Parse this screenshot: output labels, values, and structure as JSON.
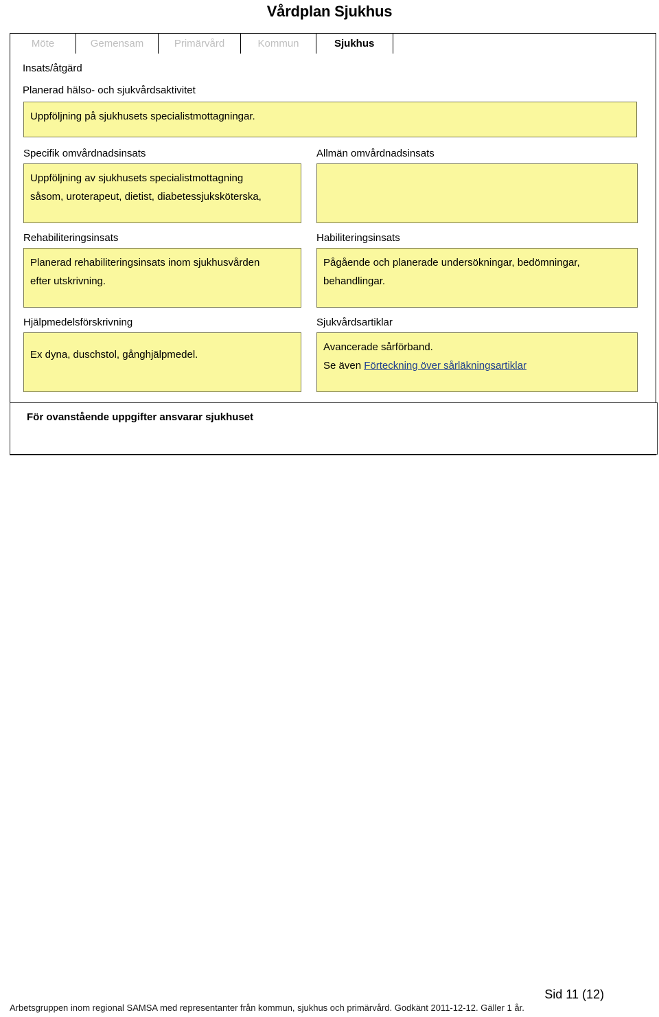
{
  "document": {
    "title": "Vårdplan Sjukhus"
  },
  "tabs": [
    {
      "label": "Möte",
      "active": false
    },
    {
      "label": "Gemensam",
      "active": false
    },
    {
      "label": "Primärvård",
      "active": false
    },
    {
      "label": "Kommun",
      "active": false
    },
    {
      "label": "Sjukhus",
      "active": true
    }
  ],
  "panel": {
    "section_heading": "Insats/åtgärd",
    "activity": {
      "label": "Planerad hälso- och sjukvårdsaktivitet",
      "value": "Uppföljning på sjukhusets specialistmottagningar."
    },
    "rows": [
      {
        "left": {
          "label": "Specifik omvårdnadsinsats",
          "lines": [
            "Uppföljning av sjukhusets specialistmottagning",
            "såsom, uroterapeut, dietist, diabetessjuksköterska,"
          ]
        },
        "right": {
          "label": "Allmän omvårdnadsinsats",
          "lines": []
        }
      },
      {
        "left": {
          "label": "Rehabiliteringsinsats",
          "lines": [
            "Planerad rehabiliteringsinsats inom sjukhusvården",
            "efter utskrivning."
          ]
        },
        "right": {
          "label": "Habiliteringsinsats",
          "lines": [
            "Pågående och planerade undersökningar, bedömningar,",
            "behandlingar."
          ]
        }
      },
      {
        "left": {
          "label": "Hjälpmedelsförskrivning",
          "lines": [
            "Ex dyna, duschstol, gånghjälpmedel."
          ]
        },
        "right": {
          "label": "Sjukvårdsartiklar",
          "lines": [
            "Avancerade sårförband."
          ],
          "link_prefix": "Se även ",
          "link_text": "Förteckning över sårläkningsartiklar"
        }
      }
    ],
    "responsibility": "För ovanstående uppgifter ansvarar sjukhuset"
  },
  "footer": {
    "page_number": "Sid 11 (12)",
    "note": "Arbetsgruppen inom regional SAMSA med representanter från kommun, sjukhus och primärvård. Godkänt 2011-12-12. Gäller 1 år."
  },
  "colors": {
    "highlight": "#faf89e",
    "highlight_border": "#7a7a50",
    "tab_inactive_text": "#bfbfbf",
    "link": "#1f3f8f"
  }
}
